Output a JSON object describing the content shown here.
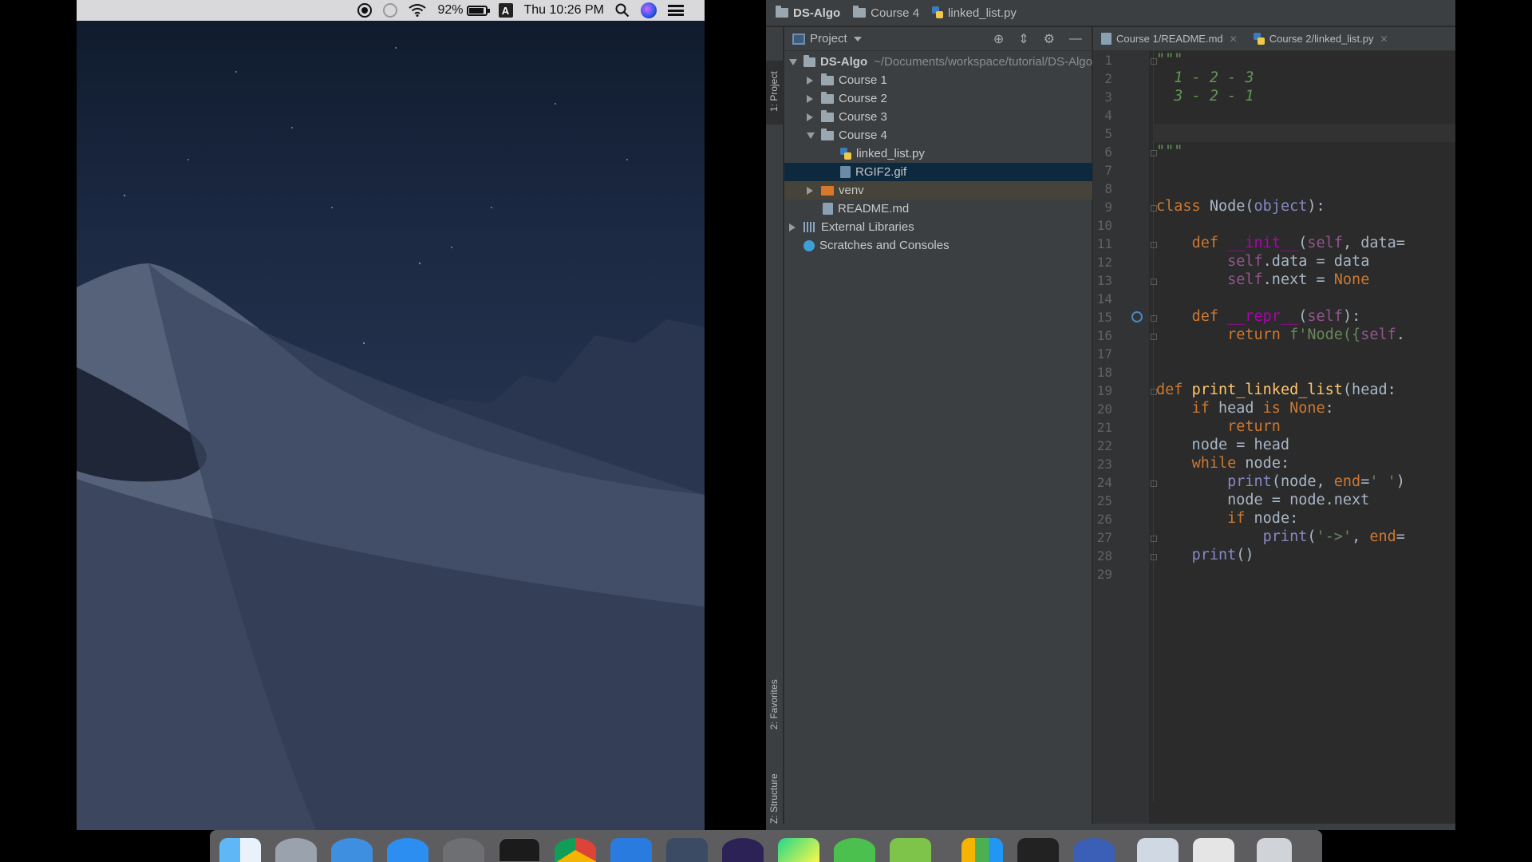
{
  "menubar": {
    "battery_percent": "92%",
    "clock": "Thu 10:26 PM",
    "icons": [
      "screen-record-icon",
      "do-not-disturb-icon",
      "wifi-icon",
      "battery-icon",
      "input-source-icon",
      "spotlight-search-icon",
      "siri-icon",
      "notification-center-icon"
    ]
  },
  "ide": {
    "breadcrumbs": [
      "DS-Algo",
      "Course 4",
      "linked_list.py"
    ],
    "toolwindow_tabs": [
      "1: Project",
      "2: Favorites",
      "Z: Structure"
    ],
    "project_panel": {
      "title": "Project",
      "tree": [
        {
          "label": "DS-Algo",
          "path": "~/Documents/workspace/tutorial/DS-Algo"
        },
        {
          "label": "Course 1"
        },
        {
          "label": "Course 2"
        },
        {
          "label": "Course 3"
        },
        {
          "label": "Course 4"
        },
        {
          "label": "linked_list.py"
        },
        {
          "label": "RGIF2.gif"
        },
        {
          "label": "venv"
        },
        {
          "label": "README.md"
        },
        {
          "label": "External Libraries"
        },
        {
          "label": "Scratches and Consoles"
        }
      ]
    },
    "editor_tabs": [
      "Course 1/README.md",
      "Course 2/linked_list.py"
    ],
    "line_numbers": [
      "1",
      "2",
      "3",
      "4",
      "5",
      "6",
      "7",
      "8",
      "9",
      "10",
      "11",
      "12",
      "13",
      "14",
      "15",
      "16",
      "17",
      "18",
      "19",
      "20",
      "21",
      "22",
      "23",
      "24",
      "25",
      "26",
      "27",
      "28",
      "29"
    ]
  },
  "colors": {
    "ide_bg": "#2b2b2b",
    "panel_bg": "#3c3f41",
    "selection": "#0d293e",
    "keyword": "#cc7832",
    "function": "#ffc66d",
    "string": "#6a8759"
  },
  "dock": {
    "icons": [
      "finder-icon",
      "launchpad-icon",
      "safari-icon",
      "app-store-icon",
      "system-preferences-icon",
      "terminal-icon",
      "chrome-icon",
      "screen-capture-icon",
      "vscode-icon",
      "eclipse-icon",
      "pycharm-icon",
      "wechat-icon",
      "sublime-icon",
      "numbers-icon",
      "typora-icon",
      "quicktime-icon",
      "files-icon",
      "preview-icon",
      "trash-icon"
    ]
  }
}
